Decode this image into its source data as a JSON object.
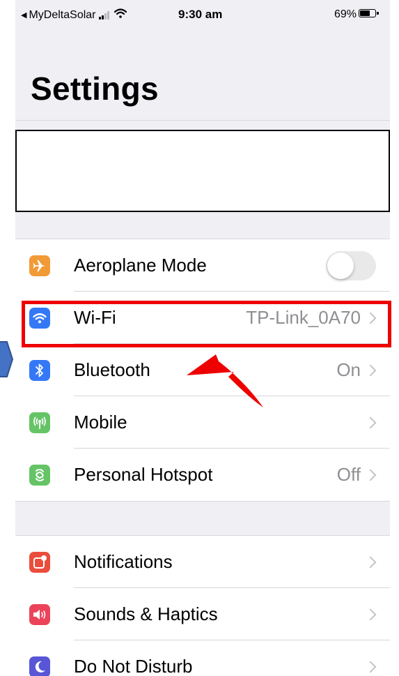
{
  "status_bar": {
    "back_app": "MyDeltaSolar",
    "time": "9:30 am",
    "battery_percent": "69%",
    "battery_level": 0.69
  },
  "page": {
    "title": "Settings"
  },
  "group1": [
    {
      "label": "Aeroplane Mode",
      "value": "",
      "icon": "airplane-icon",
      "icon_color": "#f19a37",
      "control": "toggle",
      "toggle_on": false
    },
    {
      "label": "Wi-Fi",
      "value": "TP-Link_0A70",
      "icon": "wifi-icon",
      "icon_color": "#3478f6",
      "control": "chevron"
    },
    {
      "label": "Bluetooth",
      "value": "On",
      "icon": "bluetooth-icon",
      "icon_color": "#3478f6",
      "control": "chevron"
    },
    {
      "label": "Mobile",
      "value": "",
      "icon": "antenna-icon",
      "icon_color": "#65c466",
      "control": "chevron"
    },
    {
      "label": "Personal Hotspot",
      "value": "Off",
      "icon": "hotspot-icon",
      "icon_color": "#65c466",
      "control": "chevron"
    }
  ],
  "group2": [
    {
      "label": "Notifications",
      "value": "",
      "icon": "notifications-icon",
      "icon_color": "#eb4d3d",
      "control": "chevron"
    },
    {
      "label": "Sounds & Haptics",
      "value": "",
      "icon": "speaker-icon",
      "icon_color": "#eb445a",
      "control": "chevron"
    },
    {
      "label": "Do Not Disturb",
      "value": "",
      "icon": "moon-icon",
      "icon_color": "#5856d6",
      "control": "chevron"
    }
  ],
  "annotations": {
    "highlight_color": "#ee0000",
    "arrow_color": "#ee0000",
    "pointer_color": "#4472c4"
  }
}
